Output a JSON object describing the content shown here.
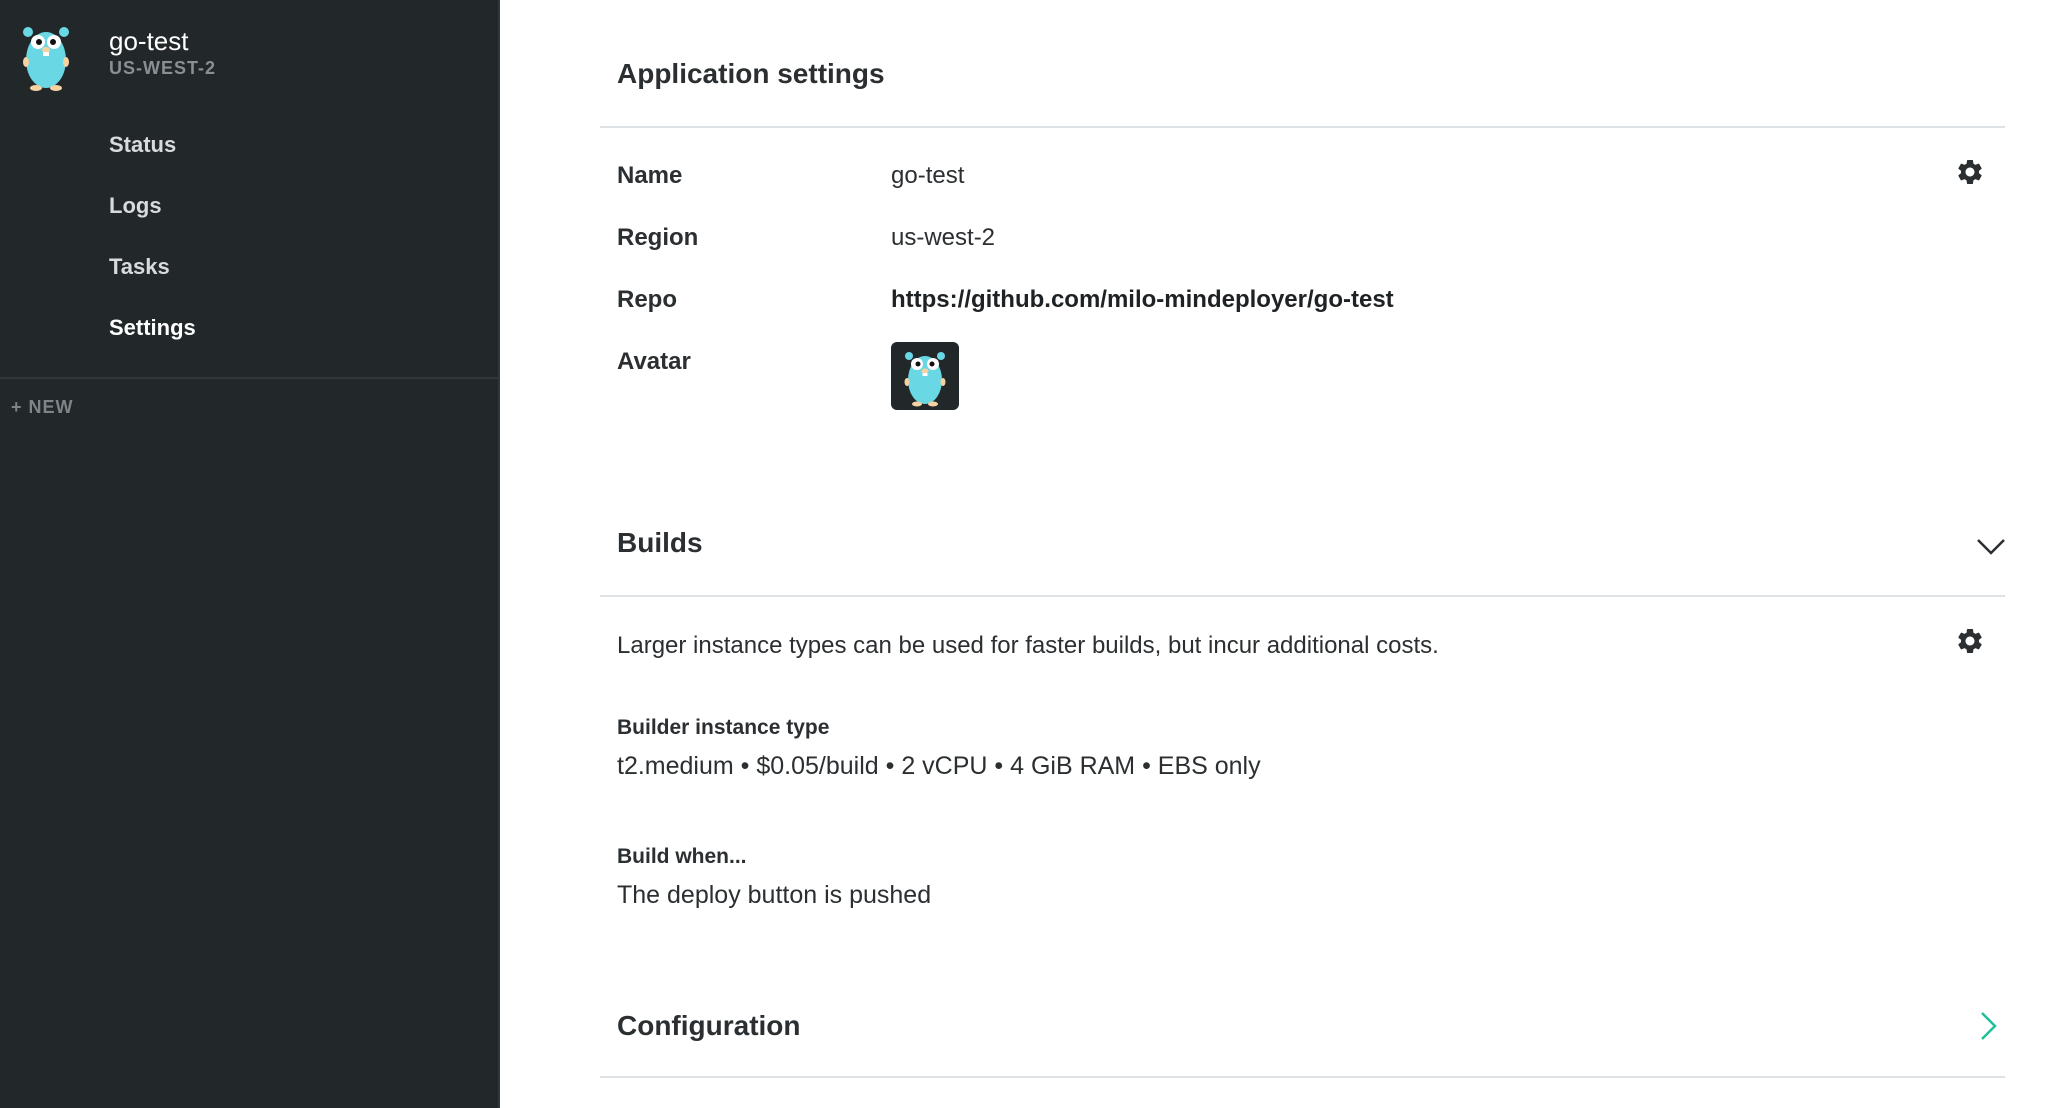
{
  "sidebar": {
    "app_name": "go-test",
    "app_region": "US-WEST-2",
    "nav": [
      {
        "label": "Status"
      },
      {
        "label": "Logs"
      },
      {
        "label": "Tasks"
      },
      {
        "label": "Settings"
      }
    ],
    "new_label": "+ NEW",
    "logo_icon": "gopher-icon"
  },
  "app_settings": {
    "title": "Application settings",
    "fields": [
      {
        "label": "Name",
        "value": "go-test"
      },
      {
        "label": "Region",
        "value": "us-west-2"
      },
      {
        "label": "Repo",
        "value": "https://github.com/milo-mindeployer/go-test"
      },
      {
        "label": "Avatar",
        "value": ""
      }
    ],
    "settings_icon": "gear-icon"
  },
  "builds": {
    "title": "Builds",
    "description": "Larger instance types can be used for faster builds, but incur additional costs.",
    "builder_label": "Builder instance type",
    "builder_value": "t2.medium • $0.05/build • 2 vCPU • 4 GiB RAM • EBS only",
    "build_when_label": "Build when...",
    "build_when_value": "The deploy button is pushed",
    "toggle_icon": "chevron-down-icon",
    "settings_icon": "gear-icon"
  },
  "configuration": {
    "title": "Configuration",
    "toggle_icon": "chevron-right-icon"
  },
  "colors": {
    "sidebar_bg": "#22272a",
    "accent_teal": "#1fbf9c",
    "gopher_blue": "#6ad7e5"
  }
}
